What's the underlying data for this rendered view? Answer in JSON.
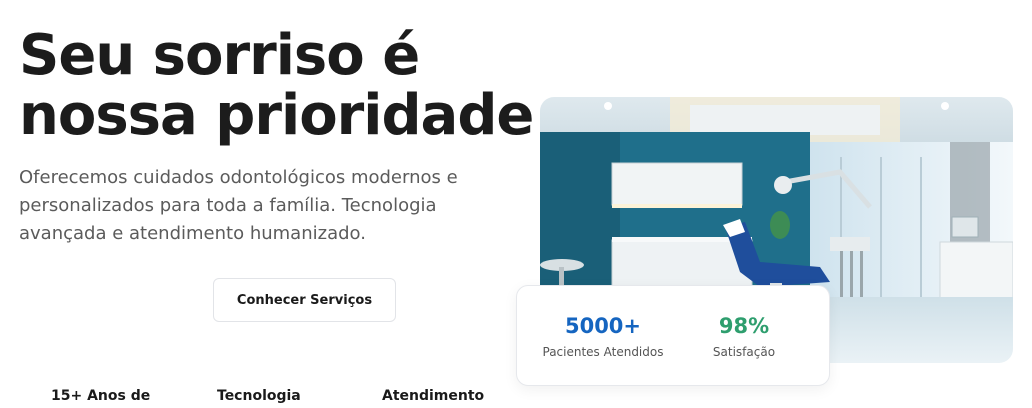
{
  "hero": {
    "headline_line1": "Seu sorriso é",
    "headline_line2": "nossa prioridade",
    "subtitle": "Oferecemos cuidados odontológicos modernos e personalizados para toda a família. Tecnologia avançada e atendimento humanizado.",
    "cta_label": "Conhecer Serviços"
  },
  "features": [
    {
      "label": "15+ Anos de"
    },
    {
      "label": "Tecnologia"
    },
    {
      "label": "Atendimento"
    }
  ],
  "stats": [
    {
      "value": "5000+",
      "label": "Pacientes Atendidos",
      "color": "#1565c0"
    },
    {
      "value": "98%",
      "label": "Satisfação",
      "color": "#2e9e6e"
    }
  ],
  "colors": {
    "stat_blue": "#1565c0",
    "stat_green": "#2e9e6e",
    "wall_teal": "#1f6f8b"
  }
}
